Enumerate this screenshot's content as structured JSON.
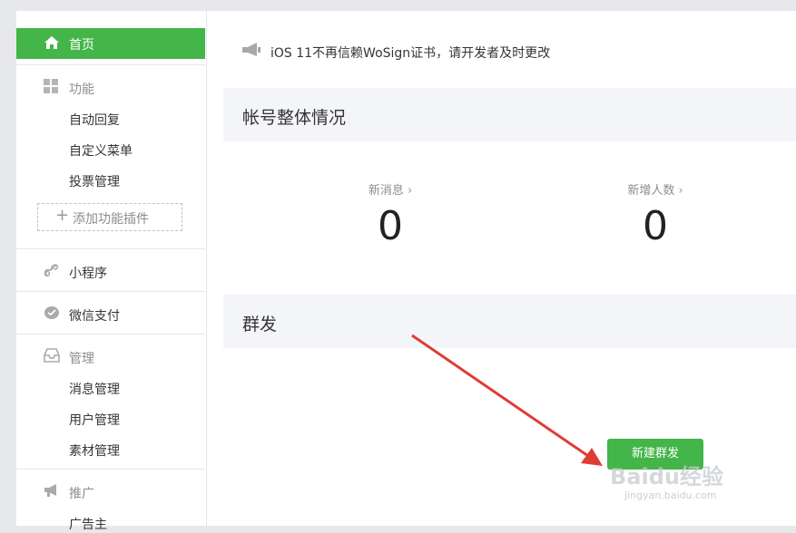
{
  "sidebar": {
    "home_label": "首页",
    "features": {
      "title": "功能",
      "items": [
        "自动回复",
        "自定义菜单",
        "投票管理"
      ],
      "add_plugin": "添加功能插件"
    },
    "mini_program": "小程序",
    "wechat_pay": "微信支付",
    "manage": {
      "title": "管理",
      "items": [
        "消息管理",
        "用户管理",
        "素材管理"
      ]
    },
    "promote": {
      "title": "推广",
      "items": [
        "广告主"
      ]
    }
  },
  "main": {
    "notice": "iOS 11不再信赖WoSign证书，请开发者及时更改",
    "account_overview": {
      "title": "帐号整体情况",
      "stats": [
        {
          "label": "新消息",
          "value": "0"
        },
        {
          "label": "新增人数",
          "value": "0"
        }
      ]
    },
    "broadcast": {
      "title": "群发",
      "new_button": "新建群发"
    }
  },
  "watermark": {
    "brand": "Baidu经验",
    "url": "jingyan.baidu.com"
  },
  "colors": {
    "accent": "#44b549",
    "annotation_arrow": "#e03c36"
  }
}
